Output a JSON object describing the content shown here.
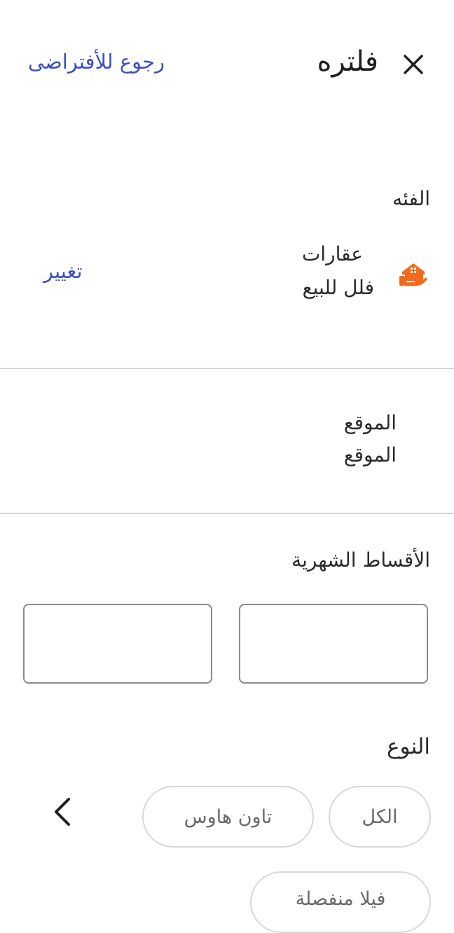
{
  "header": {
    "title": "فلتره",
    "reset_label": "رجوع للأفتراضى",
    "close_icon": "close-icon"
  },
  "category": {
    "section_label": "الفئه",
    "icon": "real-estate-icon",
    "main": "عقارات",
    "sub": "فلل للبيع",
    "change_label": "تغيير"
  },
  "location": {
    "icon": "location-pin-icon",
    "line1": "الموقع",
    "line2": "الموقع",
    "chevron_icon": "chevron-left-icon"
  },
  "installments": {
    "section_label": "الأقساط الشهرية",
    "min_value": "",
    "max_value": ""
  },
  "type": {
    "section_label": "النوع",
    "options": [
      "الكل",
      "تاون هاوس",
      "فيلا منفصلة"
    ]
  },
  "colors": {
    "accent": "#3d4fc4",
    "category_icon": "#f26b1d",
    "border": "#8a8a8e",
    "divider": "#d4d4d8"
  }
}
